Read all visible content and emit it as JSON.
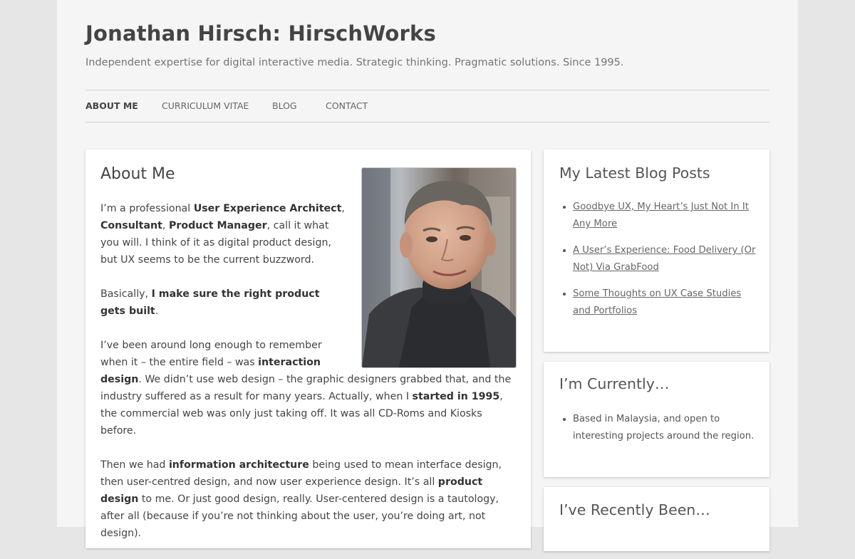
{
  "site": {
    "title": "Jonathan Hirsch: HirschWorks",
    "description": "Independent expertise for digital interactive media. Strategic thinking. Pragmatic solutions. Since 1995."
  },
  "nav": {
    "items": [
      {
        "label": "ABOUT ME",
        "current": true
      },
      {
        "label": "CURRICULUM VITAE",
        "current": false
      },
      {
        "label": "BLOG",
        "current": false
      },
      {
        "label": "CONTACT",
        "current": false
      }
    ]
  },
  "main": {
    "title": "About Me",
    "paragraphs": [
      [
        {
          "t": "I’m a professional "
        },
        {
          "t": "User Experience Architect",
          "b": true
        },
        {
          "t": ", "
        },
        {
          "t": "Consultant",
          "b": true
        },
        {
          "t": ", "
        },
        {
          "t": "Product Manager",
          "b": true
        },
        {
          "t": ", call it what you will. I think of it as digital product design, but UX seems to be the current buzzword."
        }
      ],
      [
        {
          "t": "Basically, "
        },
        {
          "t": "I make sure the right product gets built",
          "b": true
        },
        {
          "t": "."
        }
      ],
      [
        {
          "t": "I’ve been around long enough to remember when it – the entire field – was "
        },
        {
          "t": "interaction design",
          "b": true
        },
        {
          "t": ". We didn’t use web design – the graphic designers grabbed that, and the industry suffered as a result for many years. Actually, when I "
        },
        {
          "t": "started in 1995",
          "b": true
        },
        {
          "t": ", the commercial web was only just taking off. It was all CD-Roms and Kiosks before."
        }
      ],
      [
        {
          "t": "Then we had "
        },
        {
          "t": "information architecture",
          "b": true
        },
        {
          "t": " being used to mean interface design, then user-centred design, and now user experience design. It’s all "
        },
        {
          "t": "product design",
          "b": true
        },
        {
          "t": " to me. Or just good design, really. User-centered design is a tautology, after all (because if you’re not thinking about the user, you’re doing art, not design)."
        }
      ]
    ]
  },
  "sidebar": {
    "latest_posts": {
      "title": "My Latest Blog Posts",
      "items": [
        "Goodbye UX, My Heart’s Just Not In It Any More",
        "A User’s Experience: Food Delivery (Or Not) Via GrabFood",
        "Some Thoughts on UX Case Studies and Portfolios"
      ]
    },
    "currently": {
      "title": "I’m Currently…",
      "items": [
        "Based in Malaysia, and open to interesting projects around the region."
      ]
    },
    "recently": {
      "title": "I’ve Recently Been…"
    }
  },
  "colors": {
    "outer_bg": "#e6e6e6",
    "page_bg": "#f5f5f5",
    "card_bg": "#ffffff",
    "text": "#444444",
    "link": "#666666"
  }
}
